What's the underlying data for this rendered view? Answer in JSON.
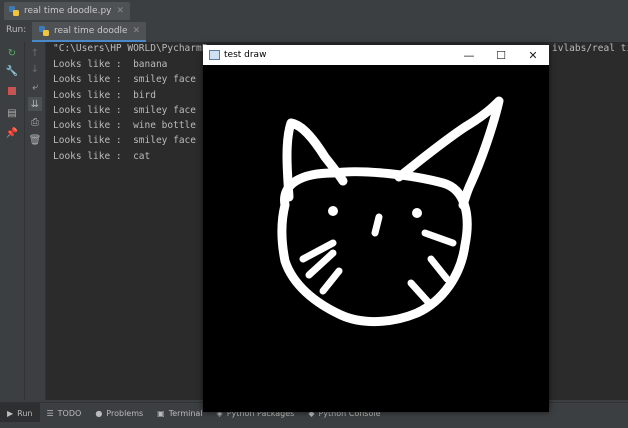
{
  "editor": {
    "file_tab": "real time doodle.py"
  },
  "run_panel": {
    "label": "Run:",
    "config_tab": "real time doodle",
    "command_start": "\"C:\\Users\\HP WORLD\\PycharmP",
    "command_end": "ivlabs/real ti",
    "lines": [
      "Looks like :  banana",
      "Looks like :  smiley face",
      "Looks like :  bird",
      "Looks like :  smiley face",
      "Looks like :  wine bottle",
      "Looks like :  smiley face",
      "Looks like :  cat"
    ]
  },
  "bottom_toolbar": {
    "run": "Run",
    "todo": "TODO",
    "problems": "Problems",
    "terminal": "Terminal",
    "python_packages": "Python Packages",
    "python_console": "Python Console"
  },
  "drawing_window": {
    "title": "test draw",
    "minimize": "—",
    "maximize": "☐",
    "close": "✕",
    "doodle": "cat"
  },
  "colors": {
    "ide_bg": "#3c3f41",
    "console_bg": "#2b2b2b",
    "console_text": "#bbbbbb",
    "run_green": "#59a869",
    "stop_red": "#c75450",
    "canvas_bg": "#000000",
    "stroke": "#ffffff"
  }
}
